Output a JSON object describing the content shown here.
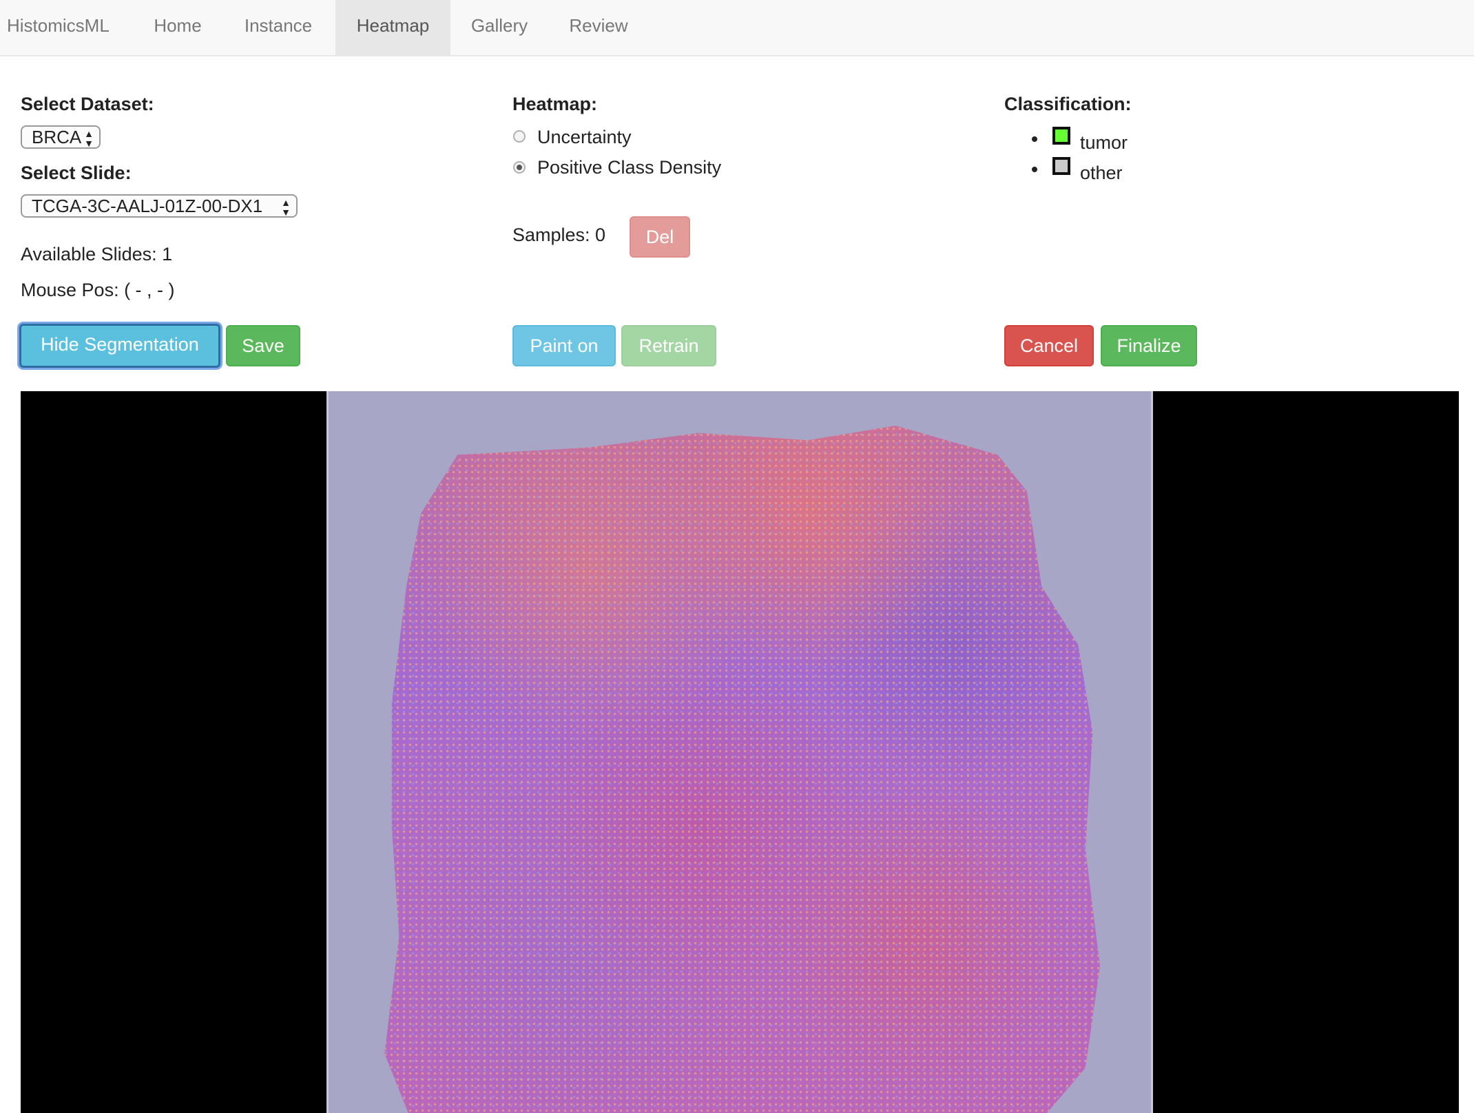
{
  "navbar": {
    "brand": "HistomicsML",
    "items": [
      {
        "label": "Home",
        "active": false
      },
      {
        "label": "Instance",
        "active": false
      },
      {
        "label": "Heatmap",
        "active": true
      },
      {
        "label": "Gallery",
        "active": false
      },
      {
        "label": "Review",
        "active": false
      }
    ]
  },
  "left": {
    "dataset_label": "Select Dataset:",
    "dataset_value": "BRCA",
    "slide_label": "Select Slide:",
    "slide_value": "TCGA-3C-AALJ-01Z-00-DX1",
    "available_slides": "Available Slides: 1",
    "mouse_pos": "Mouse Pos: ( - , - )",
    "hide_segmentation_label": "Hide Segmentation",
    "save_label": "Save"
  },
  "middle": {
    "heatmap_label": "Heatmap:",
    "options": [
      {
        "label": "Uncertainty",
        "checked": false
      },
      {
        "label": "Positive Class Density",
        "checked": true
      }
    ],
    "samples": "Samples: 0",
    "del_label": "Del",
    "paint_label": "Paint on",
    "retrain_label": "Retrain"
  },
  "right": {
    "classification_label": "Classification:",
    "classes": [
      {
        "label": "tumor",
        "color": "#66ff33"
      },
      {
        "label": "other",
        "color": "#cccccc"
      }
    ],
    "cancel_label": "Cancel",
    "finalize_label": "Finalize"
  },
  "colors": {
    "primary": "#5bc0de",
    "success": "#5cb85c",
    "danger": "#d9534f"
  }
}
